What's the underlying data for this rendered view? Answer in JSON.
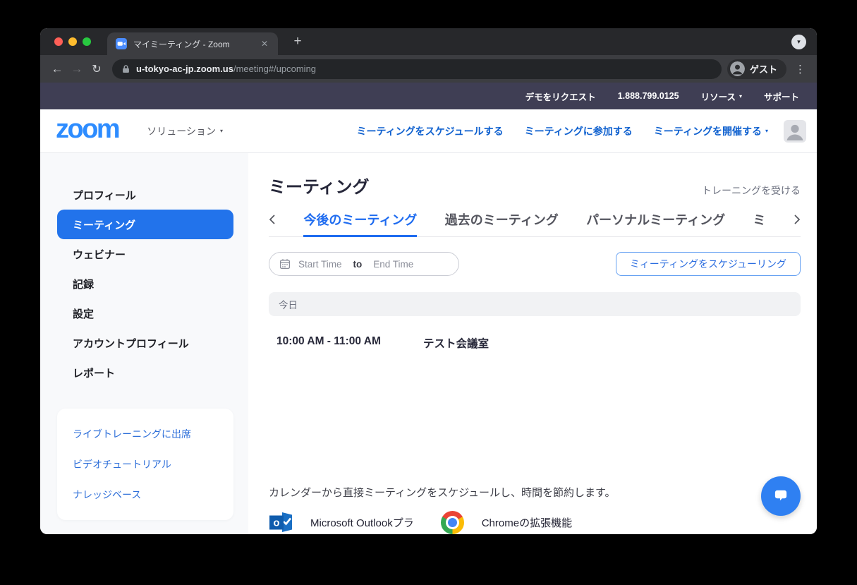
{
  "browser": {
    "tab_title": "マイミーティング - Zoom",
    "url_host": "u-tokyo-ac-jp.zoom.us",
    "url_path": "/meeting#/upcoming",
    "guest_label": "ゲスト"
  },
  "topnav": {
    "items": [
      "デモをリクエスト",
      "1.888.799.0125",
      "リソース",
      "サポート"
    ]
  },
  "header": {
    "logo_text": "zoom",
    "solutions_label": "ソリューション",
    "links": [
      "ミーティングをスケジュールする",
      "ミーティングに参加する",
      "ミーティングを開催する"
    ]
  },
  "sidebar": {
    "items": [
      {
        "label": "プロフィール"
      },
      {
        "label": "ミーティング",
        "active": true
      },
      {
        "label": "ウェビナー"
      },
      {
        "label": "記録"
      },
      {
        "label": "設定"
      },
      {
        "label": "アカウントプロフィール"
      },
      {
        "label": "レポート"
      }
    ],
    "help_links": [
      {
        "label": "ライブトレーニングに出席"
      },
      {
        "label": "ビデオチュートリアル"
      },
      {
        "label": "ナレッジベース"
      }
    ]
  },
  "main": {
    "title": "ミーティング",
    "training_link": "トレーニングを受ける",
    "tabs": [
      {
        "label": "今後のミーティング",
        "active": true
      },
      {
        "label": "過去のミーティング"
      },
      {
        "label": "パーソナルミーティング"
      },
      {
        "label": "ミ"
      }
    ],
    "filter": {
      "start_placeholder": "Start Time",
      "to_label": "to",
      "end_placeholder": "End Time"
    },
    "schedule_button_label": "ミィーティングをスケジューリング",
    "day_label": "今日",
    "meetings": [
      {
        "time": "10:00 AM - 11:00 AM",
        "topic": "テスト会議室"
      }
    ],
    "promo_text": "カレンダーから直接ミーティングをスケジュールし、時間を節約します。",
    "integrations": [
      {
        "label": "Microsoft Outlookプラ",
        "icon_letter": "o"
      },
      {
        "label": "Chromeの拡張機能"
      }
    ]
  },
  "icons": {
    "caret": "▾",
    "back": "←",
    "forward": "→",
    "reload": "↻",
    "close": "✕",
    "new_tab": "+",
    "kebab": "⋮"
  },
  "colors": {
    "brand_blue": "#2d8cff",
    "active_nav_blue": "#2273eb",
    "tab_active_blue": "#1f6cf0",
    "link_blue": "#0e60cf",
    "topnav_bg": "#3f3e54",
    "chrome_dark": "#27282b",
    "sidebar_bg": "#f8f9fb",
    "day_bar_bg": "#f1f2f4"
  }
}
